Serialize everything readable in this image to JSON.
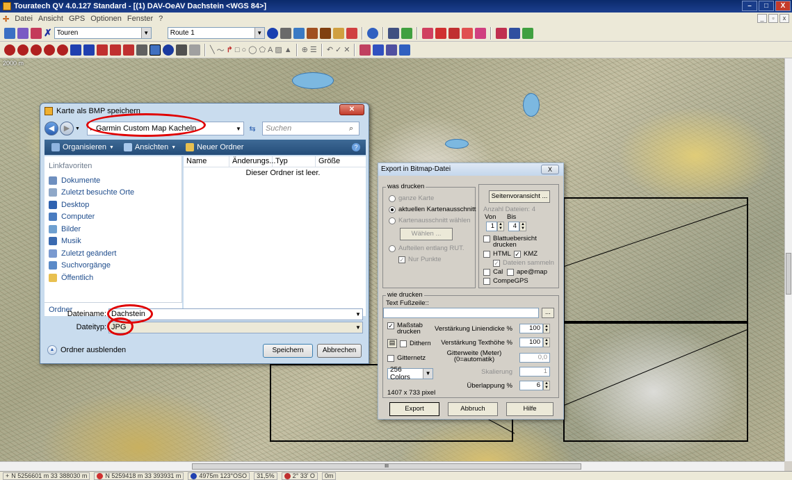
{
  "window": {
    "title": "Touratech QV 4.0.127 Standard - [(1) DAV-OeAV Dachstein <WGS 84>]",
    "controls": [
      "–",
      "□",
      "X"
    ]
  },
  "menu": {
    "items": [
      "Datei",
      "Ansicht",
      "GPS",
      "Optionen",
      "Fenster",
      "?"
    ]
  },
  "toolbar1": {
    "touren_combo": "Touren",
    "route_combo": "Route 1"
  },
  "map": {
    "scale_label": "2000 m"
  },
  "hscroll_thumb": "III",
  "status": {
    "coord1": "N 5256601 m 33 388030 m",
    "coord2": "N 5259418 m 33 393931 m",
    "distance": "4975m 123°OSO",
    "zoom": "31,5%",
    "angle": "2° 33' O",
    "alt": "0m"
  },
  "save_dialog": {
    "title": "Karte als BMP speichern",
    "address": "Garmin Custom Map Kacheln",
    "search_placeholder": "Suchen",
    "cmd_organize": "Organisieren",
    "cmd_views": "Ansichten",
    "cmd_newfolder": "Neuer Ordner",
    "links_header": "Linkfavoriten",
    "links": [
      "Dokumente",
      "Zuletzt besuchte Orte",
      "Desktop",
      "Computer",
      "Bilder",
      "Musik",
      "Zuletzt geändert",
      "Suchvorgänge",
      "Öffentlich"
    ],
    "ordner_label": "Ordner",
    "columns": [
      "Name",
      "Änderungs...",
      "Typ",
      "Größe"
    ],
    "empty_msg": "Dieser Ordner ist leer.",
    "filename_label": "Dateiname:",
    "filename_value": "Dachstein",
    "filetype_label": "Dateityp:",
    "filetype_value": "JPG",
    "hide_folders": "Ordner ausblenden",
    "save_btn": "Speichern",
    "cancel_btn": "Abbrechen"
  },
  "export_dialog": {
    "title": "Export in Bitmap-Datei",
    "close": "X",
    "what_print": "was drucken",
    "opt_whole": "ganze Karte",
    "opt_current": "aktuellen Kartenausschnitt",
    "opt_select": "Kartenausschnitt wählen",
    "btn_select": "Wählen ...",
    "opt_split": "Aufteilen entlang RUT.",
    "opt_points": "Nur Punkte",
    "btn_preview": "Seitenvoransicht ...",
    "file_count": "Anzahl Dateien: 4",
    "von_label": "Von",
    "bis_label": "Bis",
    "von_value": "1",
    "bis_value": "4",
    "opt_overview": "Blattuebersicht drucken",
    "opt_html": "HTML",
    "opt_kmz": "KMZ",
    "opt_collect": "Dateien sammeln",
    "opt_cal": "Cal",
    "opt_apemap": "ape@map",
    "opt_compegps": "CompeGPS",
    "how_print": "wie drucken",
    "footer_label": "Text Fußzeile::",
    "footer_value": "",
    "browse": "...",
    "opt_scale": "Maßstab drucken",
    "opt_dither": "Dithern",
    "opt_grid": "Gitternetz",
    "color_combo": "256 Colors",
    "line_label": "Verstärkung Liniendicke %",
    "line_value": "100",
    "text_label": "Verstärkung Texthöhe %",
    "text_value": "100",
    "grid_label": "Gitterweite (Meter) (0=automatik)",
    "grid_value": "0,0",
    "scale_label": "Skalierung",
    "scale_value": "1",
    "overlap_label": "Überlappung %",
    "overlap_value": "6",
    "pixel_size": "1407 x 733 pixel",
    "btn_export": "Export",
    "btn_abort": "Abbruch",
    "btn_help": "Hilfe"
  }
}
